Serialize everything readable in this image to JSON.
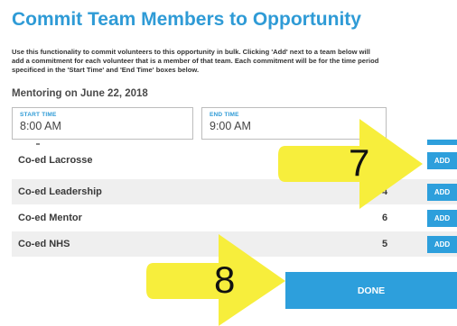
{
  "page": {
    "title": "Commit Team Members to Opportunity",
    "description": "Use this functionality to commit volunteers to this opportunity in bulk. Clicking 'Add' next to a team below will\nadd a commitment for each volunteer that is a member of that team. Each commitment will be for the time period\nspecificed in the 'Start Time' and 'End Time' boxes below.",
    "event": "Mentoring on June 22, 2018"
  },
  "time": {
    "start_label": "START TIME",
    "start_value": "8:00 AM",
    "end_label": "END TIME",
    "end_value": "9:00 AM"
  },
  "teams": [
    {
      "name": "Co-ed Lacrosse",
      "count": "",
      "add_label": "ADD"
    },
    {
      "name": "Co-ed Leadership",
      "count": "4",
      "add_label": "ADD"
    },
    {
      "name": "Co-ed Mentor",
      "count": "6",
      "add_label": "ADD"
    },
    {
      "name": "Co-ed NHS",
      "count": "5",
      "add_label": "ADD"
    }
  ],
  "done_label": "DONE",
  "callouts": [
    {
      "number": "7",
      "color": "#f7ee3c",
      "icon": "arrow-right-icon"
    },
    {
      "number": "8",
      "color": "#f7ee3c",
      "icon": "arrow-right-icon"
    }
  ],
  "colors": {
    "accent": "#2d9fdc",
    "title": "#2f9bd6",
    "callout": "#f7ee3c"
  }
}
